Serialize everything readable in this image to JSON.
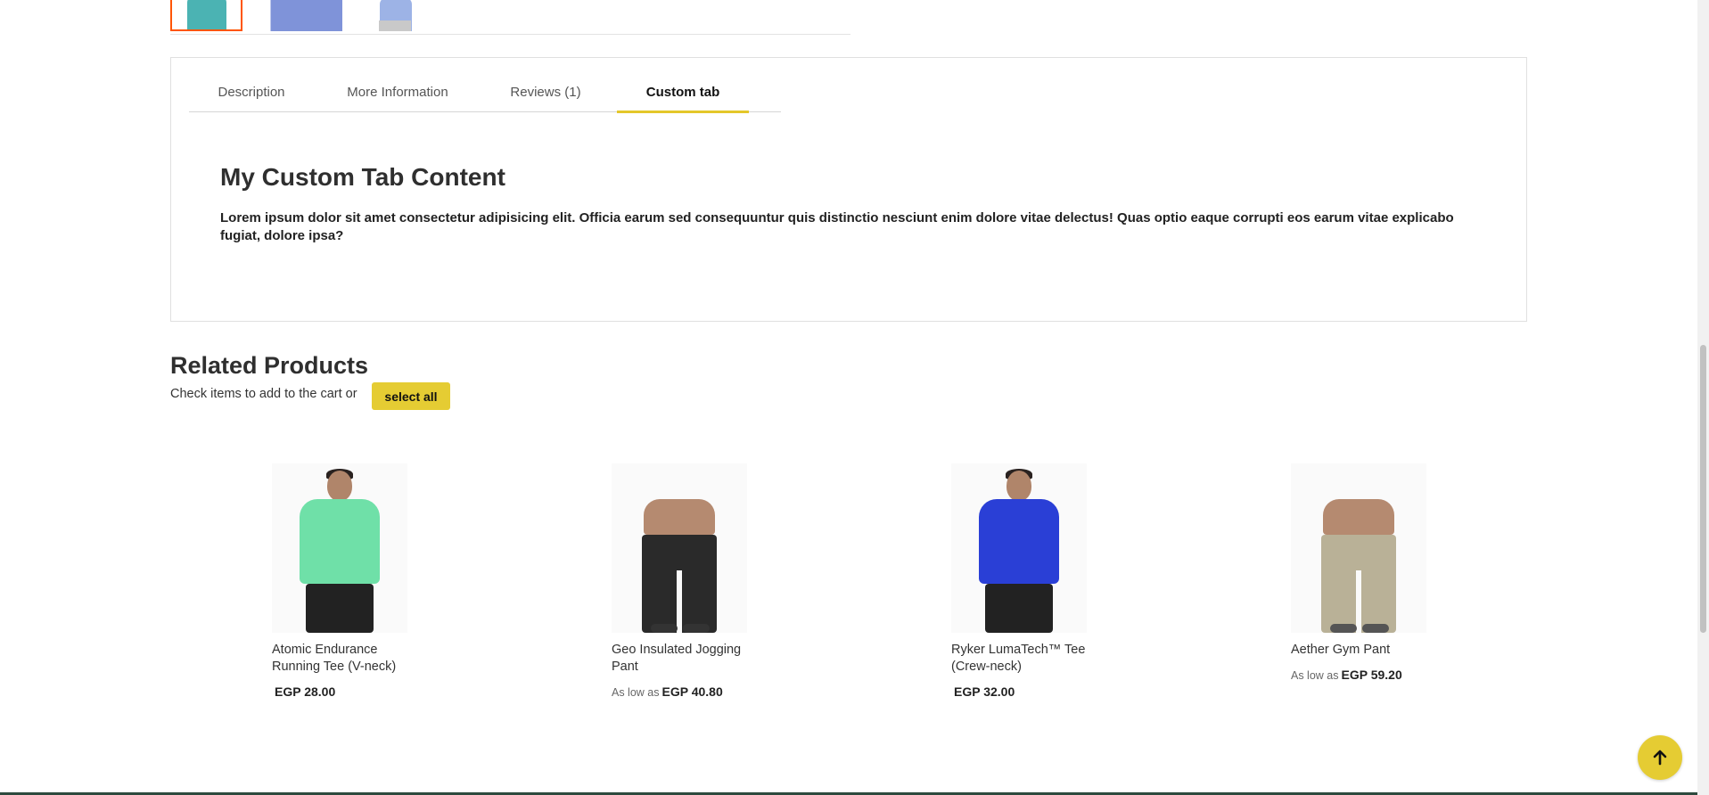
{
  "tabs": [
    {
      "label": "Description",
      "active": false
    },
    {
      "label": "More Information",
      "active": false
    },
    {
      "label": "Reviews (1)",
      "active": false
    },
    {
      "label": "Custom tab",
      "active": true
    }
  ],
  "tab_content": {
    "title": "My Custom Tab Content",
    "text": "Lorem ipsum dolor sit amet consectetur adipisicing elit. Officia earum sed consequuntur quis distinctio nesciunt enim dolore vitae delectus! Quas optio eaque corrupti eos earum vitae explicabo fugiat, dolore ipsa?"
  },
  "related": {
    "title": "Related Products",
    "note": "Check items to add to the cart or",
    "select_all_label": "select all",
    "products": [
      {
        "name": "Atomic Endurance Running Tee (V-neck)",
        "price_prefix": "",
        "price": "EGP 28.00"
      },
      {
        "name": "Geo Insulated Jogging Pant",
        "price_prefix": "As low as",
        "price": "EGP 40.80"
      },
      {
        "name": "Ryker LumaTech™ Tee (Crew-neck)",
        "price_prefix": "",
        "price": "EGP 32.00"
      },
      {
        "name": "Aether Gym Pant",
        "price_prefix": "As low as",
        "price": "EGP 59.20"
      }
    ]
  },
  "colors": {
    "accent": "#e5cc33",
    "active_thumb_border": "#ff5501",
    "footer_line": "#2d4a3e"
  },
  "icons": {
    "scroll_top": "arrow-up-icon"
  }
}
